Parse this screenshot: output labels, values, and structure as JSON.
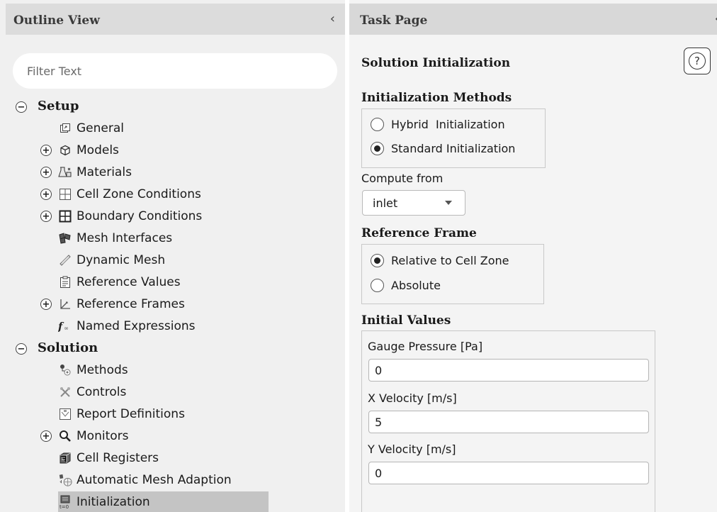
{
  "outline": {
    "title": "Outline View",
    "collapse_glyph": "‹",
    "filter_placeholder": "Filter Text",
    "setup": {
      "label": "Setup",
      "items": [
        {
          "label": "General",
          "icon": "general-icon",
          "expandable": false
        },
        {
          "label": "Models",
          "icon": "models-icon",
          "expandable": true
        },
        {
          "label": "Materials",
          "icon": "materials-icon",
          "expandable": true
        },
        {
          "label": "Cell Zone Conditions",
          "icon": "cell-zone-icon",
          "expandable": true
        },
        {
          "label": "Boundary Conditions",
          "icon": "boundary-icon",
          "expandable": true
        },
        {
          "label": "Mesh Interfaces",
          "icon": "mesh-interfaces-icon",
          "expandable": false
        },
        {
          "label": "Dynamic Mesh",
          "icon": "dynamic-mesh-icon",
          "expandable": false
        },
        {
          "label": "Reference Values",
          "icon": "reference-values-icon",
          "expandable": false
        },
        {
          "label": "Reference Frames",
          "icon": "reference-frames-icon",
          "expandable": true
        },
        {
          "label": "Named Expressions",
          "icon": "named-expressions-icon",
          "expandable": false
        }
      ]
    },
    "solution": {
      "label": "Solution",
      "items": [
        {
          "label": "Methods",
          "icon": "methods-icon",
          "expandable": false
        },
        {
          "label": "Controls",
          "icon": "controls-icon",
          "expandable": false
        },
        {
          "label": "Report Definitions",
          "icon": "report-definitions-icon",
          "expandable": false
        },
        {
          "label": "Monitors",
          "icon": "monitors-icon",
          "expandable": true
        },
        {
          "label": "Cell Registers",
          "icon": "cell-registers-icon",
          "expandable": false
        },
        {
          "label": "Automatic Mesh Adaption",
          "icon": "mesh-adaption-icon",
          "expandable": false
        },
        {
          "label": "Initialization",
          "icon": "initialization-icon",
          "expandable": false,
          "selected": true
        }
      ]
    }
  },
  "task": {
    "title": "Task Page",
    "collapse_glyph": "‹",
    "panel_title": "Solution Initialization",
    "help_glyph": "?",
    "init_methods": {
      "label": "Initialization Methods",
      "options": [
        {
          "label": "Hybrid  Initialization",
          "selected": false
        },
        {
          "label": "Standard Initialization",
          "selected": true
        }
      ]
    },
    "compute_from": {
      "label": "Compute from",
      "value": "inlet"
    },
    "reference_frame": {
      "label": "Reference Frame",
      "options": [
        {
          "label": "Relative to Cell Zone",
          "selected": true
        },
        {
          "label": "Absolute",
          "selected": false
        }
      ]
    },
    "initial_values": {
      "label": "Initial Values",
      "fields": [
        {
          "label": "Gauge Pressure [Pa]",
          "value": "0"
        },
        {
          "label": "X Velocity [m/s]",
          "value": "5"
        },
        {
          "label": "Y Velocity [m/s]",
          "value": "0"
        }
      ]
    }
  }
}
